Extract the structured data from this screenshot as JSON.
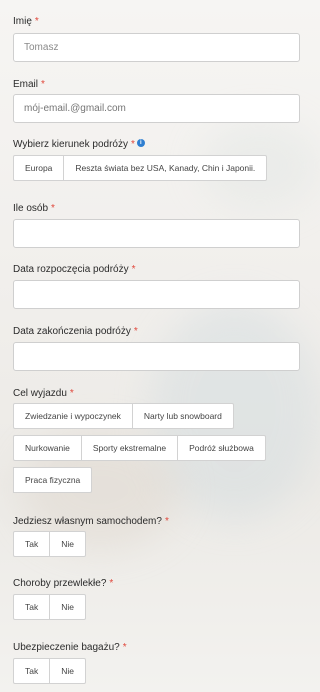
{
  "fields": {
    "name": {
      "label": "Imię",
      "value": "Tomasz"
    },
    "email": {
      "label": "Email",
      "placeholder": "mój-email.@gmail.com"
    },
    "direction": {
      "label": "Wybierz kierunek podróży",
      "options": [
        "Europa",
        "Reszta świata bez USA, Kanady, Chin i Japonii."
      ]
    },
    "people": {
      "label": "Ile osób"
    },
    "start_date": {
      "label": "Data rozpoczęcia podróży"
    },
    "end_date": {
      "label": "Data zakończenia podróży"
    },
    "purpose": {
      "label": "Cel wyjazdu",
      "row1": [
        "Zwiedzanie i wypoczynek",
        "Narty lub snowboard"
      ],
      "row2": [
        "Nurkowanie",
        "Sporty ekstremalne",
        "Podróż służbowa"
      ],
      "row3": [
        "Praca fizyczna"
      ]
    },
    "own_car": {
      "label": "Jedziesz własnym samochodem?",
      "options": [
        "Tak",
        "Nie"
      ]
    },
    "chronic": {
      "label": "Choroby przewlekłe?",
      "options": [
        "Tak",
        "Nie"
      ]
    },
    "luggage": {
      "label": "Ubezpieczenie bagażu?",
      "options": [
        "Tak",
        "Nie"
      ]
    }
  },
  "required_marker": "*",
  "info_icon": "i",
  "colors": {
    "required": "#e0463a",
    "info": "#2f7fd0"
  }
}
